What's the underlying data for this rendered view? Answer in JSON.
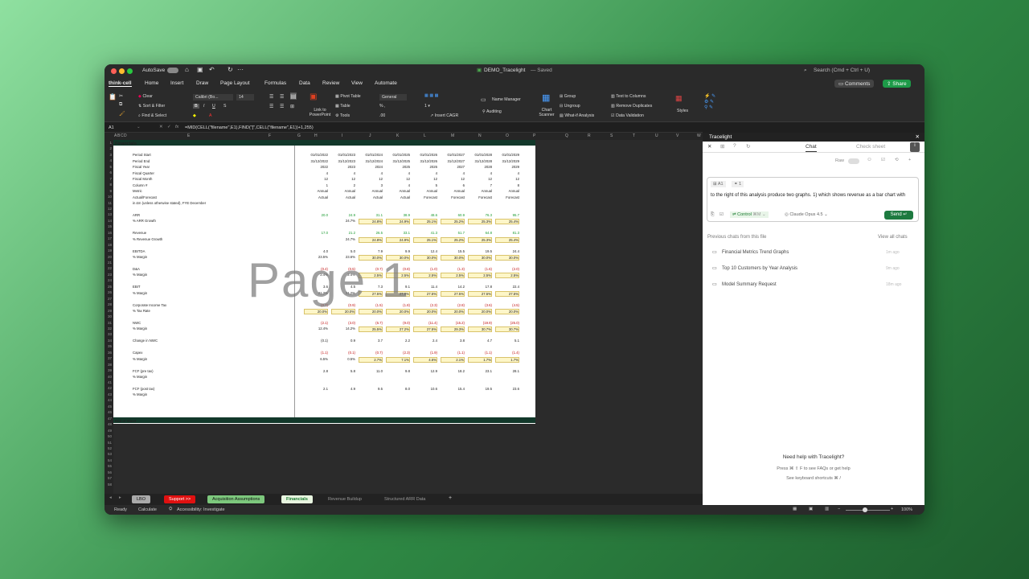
{
  "window": {
    "title": "DEMO_Tracelight",
    "saved": "— Saved",
    "search": "Search (Cmd + Ctrl + U)",
    "autosave": "AutoSave"
  },
  "ribbon_tabs": [
    "think-cell",
    "Home",
    "Insert",
    "Draw",
    "Page Layout",
    "Formulas",
    "Data",
    "Review",
    "View",
    "Automate"
  ],
  "top_buttons": {
    "comments": "Comments",
    "share": "Share"
  },
  "ribbon": {
    "clear": "Clear",
    "sort": "Sort & Filter",
    "find": "Find & Select",
    "font": "Calibri (Bo...",
    "size": "14",
    "ppt": "Link to PowerPoint",
    "pivot": "Pivot Table",
    "table": "Table",
    "tools": "Tools",
    "numfmt": "General",
    "cagr": "Insert CAGR",
    "name_manager": "Name Manager",
    "auditing": "Auditing",
    "chart_scanner": "Chart Scanner",
    "group": "Group",
    "ungroup": "Ungroup",
    "whatif": "What-if Analysis",
    "text_cols": "Text to Columns",
    "remove_dup": "Remove Duplicates",
    "validation": "Data Validation",
    "styles": "Styles"
  },
  "formula_bar": {
    "cell": "A1",
    "formula": "=MID(CELL(\"filename\",E1),FIND(\"]\",CELL(\"filename\",E1))+1,255)"
  },
  "columns": [
    "A",
    "B",
    "C",
    "D",
    "E",
    "F",
    "G",
    "H",
    "I",
    "J",
    "K",
    "L",
    "M",
    "N",
    "O",
    "P",
    "Q",
    "R",
    "S",
    "T",
    "U",
    "V",
    "W"
  ],
  "sheet": {
    "title": "Financials",
    "footer": "End of Sheet",
    "header_rows": [
      {
        "label": "Period Start",
        "values": [
          "01/01/2022",
          "01/01/2023",
          "01/01/2024",
          "01/01/2025",
          "01/01/2026",
          "01/01/2027",
          "01/01/2028",
          "01/01/2029"
        ]
      },
      {
        "label": "Period End",
        "values": [
          "31/12/2022",
          "31/12/2023",
          "31/12/2024",
          "31/12/2025",
          "31/12/2026",
          "31/12/2027",
          "31/12/2028",
          "31/12/2029"
        ]
      },
      {
        "label": "Fiscal Year",
        "values": [
          "2022",
          "2023",
          "2024",
          "2025",
          "2026",
          "2027",
          "2028",
          "2029"
        ]
      },
      {
        "label": "Fiscal Quarter",
        "values": [
          "4",
          "4",
          "4",
          "4",
          "4",
          "4",
          "4",
          "4"
        ]
      },
      {
        "label": "Fiscal Month",
        "values": [
          "12",
          "12",
          "12",
          "12",
          "12",
          "12",
          "12",
          "12"
        ]
      },
      {
        "label": "Column #",
        "values": [
          "1",
          "2",
          "3",
          "4",
          "5",
          "6",
          "7",
          "8"
        ]
      },
      {
        "label": "Metric",
        "values": [
          "Annual",
          "Annual",
          "Annual",
          "Annual",
          "Annual",
          "Annual",
          "Annual",
          "Annual"
        ]
      },
      {
        "label": "Actual/Forecast",
        "values": [
          "Actual",
          "Actual",
          "Actual",
          "Actual",
          "Forecast",
          "Forecast",
          "Forecast",
          "Forecast"
        ]
      },
      {
        "label": "in £m (unless otherwise stated), FYE December",
        "values": []
      }
    ],
    "data_rows": [
      {
        "row": 13,
        "label": "ARR",
        "color": "green",
        "values": [
          "20.0",
          "24.9",
          "31.1",
          "38.9",
          "48.6",
          "60.9",
          "76.3",
          "95.7"
        ]
      },
      {
        "row": 14,
        "label": "% ARR Growth",
        "color": "black",
        "values": [
          "",
          "24.7%",
          "24.8%",
          "24.9%",
          "25.1%",
          "25.2%",
          "25.3%",
          "25.4%"
        ]
      },
      {
        "row": 16,
        "label": "Revenue",
        "color": "green",
        "values": [
          "17.0",
          "21.2",
          "26.5",
          "33.1",
          "41.3",
          "51.7",
          "64.8",
          "81.3"
        ]
      },
      {
        "row": 17,
        "label": "% Revenue Growth",
        "color": "black",
        "values": [
          "",
          "24.7%",
          "24.8%",
          "24.9%",
          "25.1%",
          "25.2%",
          "25.3%",
          "25.4%"
        ]
      },
      {
        "row": 19,
        "label": "EBITDA",
        "color": "black",
        "values": [
          "4.0",
          "5.0",
          "7.9",
          "9.9",
          "12.4",
          "15.5",
          "19.5",
          "24.4"
        ]
      },
      {
        "row": 20,
        "label": "% Margin",
        "color": "black",
        "values": [
          "23.5%",
          "23.6%",
          "30.0%",
          "30.0%",
          "30.0%",
          "30.0%",
          "30.0%",
          "30.0%"
        ]
      },
      {
        "row": 22,
        "label": "D&A",
        "color": "red",
        "values": [
          "(0.4)",
          "(0.5)",
          "(0.7)",
          "(0.8)",
          "(1.0)",
          "(1.3)",
          "(1.6)",
          "(2.0)"
        ]
      },
      {
        "row": 23,
        "label": "% Margin",
        "color": "black",
        "values": [
          "2.4%",
          "2.4%",
          "2.5%",
          "2.5%",
          "2.5%",
          "2.5%",
          "2.5%",
          "2.5%"
        ]
      },
      {
        "row": 25,
        "label": "EBIT",
        "color": "black",
        "values": [
          "3.6",
          "4.5",
          "7.3",
          "9.1",
          "11.4",
          "14.2",
          "17.8",
          "22.4"
        ]
      },
      {
        "row": 26,
        "label": "% Margin",
        "color": "black",
        "values": [
          "21.2%",
          "21.2%",
          "27.5%",
          "27.5%",
          "27.5%",
          "27.5%",
          "27.5%",
          "27.5%"
        ]
      },
      {
        "row": 28,
        "label": "Corporate Income Tax",
        "color": "red",
        "values": [
          "(0.7)",
          "(0.9)",
          "(1.5)",
          "(1.8)",
          "(2.3)",
          "(2.8)",
          "(3.6)",
          "(4.5)"
        ]
      },
      {
        "row": 29,
        "label": "% Tax Rate",
        "color": "black",
        "values": [
          "20.0%",
          "20.0%",
          "20.0%",
          "20.0%",
          "20.0%",
          "20.0%",
          "20.0%",
          "20.0%"
        ]
      },
      {
        "row": 31,
        "label": "NWC",
        "color": "red",
        "values": [
          "(2.1)",
          "(3.0)",
          "(6.7)",
          "(9.0)",
          "(11.4)",
          "(15.2)",
          "(19.9)",
          "(25.0)"
        ]
      },
      {
        "row": 32,
        "label": "% Margin",
        "color": "black",
        "values": [
          "12.4%",
          "14.2%",
          "25.5%",
          "27.2%",
          "27.5%",
          "29.3%",
          "30.7%",
          "30.7%"
        ]
      },
      {
        "row": 34,
        "label": "Change in NWC",
        "color": "black",
        "values": [
          "(0.1)",
          "0.9",
          "3.7",
          "2.2",
          "2.4",
          "3.8",
          "4.7",
          "5.1"
        ]
      },
      {
        "row": 36,
        "label": "Capex",
        "color": "red",
        "values": [
          "(1.1)",
          "(0.1)",
          "(0.7)",
          "(2.3)",
          "(1.9)",
          "(1.1)",
          "(1.1)",
          "(1.4)"
        ]
      },
      {
        "row": 37,
        "label": "% Margin",
        "color": "black",
        "values": [
          "6.5%",
          "0.5%",
          "2.7%",
          "7.1%",
          "4.6%",
          "2.1%",
          "1.7%",
          "1.7%"
        ]
      },
      {
        "row": 39,
        "label": "FCF (pre tax)",
        "color": "black",
        "values": [
          "2.8",
          "5.8",
          "11.0",
          "9.8",
          "12.9",
          "18.2",
          "23.1",
          "28.1"
        ]
      },
      {
        "row": 40,
        "label": "% Margin",
        "color": "black",
        "values": []
      },
      {
        "row": 42,
        "label": "FCF (post tax)",
        "color": "black",
        "values": [
          "2.1",
          "4.9",
          "9.5",
          "8.0",
          "10.6",
          "15.4",
          "19.5",
          "23.6"
        ]
      },
      {
        "row": 43,
        "label": "% Margin",
        "color": "black",
        "values": []
      }
    ]
  },
  "watermark": "Page 1",
  "sheet_tabs": [
    {
      "label": "LBO",
      "style": "gray"
    },
    {
      "label": "Support >>",
      "style": "red"
    },
    {
      "label": "Acquisition Assumptions",
      "style": "green"
    },
    {
      "label": "Financials",
      "style": "active"
    },
    {
      "label": "Revenue Buildup",
      "style": "plain"
    },
    {
      "label": "Structured ARR Data",
      "style": "plain"
    }
  ],
  "status": {
    "ready": "Ready",
    "calculate": "Calculate",
    "accessibility": "Accessibility: Investigate",
    "zoom": "100%"
  },
  "panel": {
    "title": "Tracelight",
    "tab_chat": "Chat",
    "tab_check": "Check sheet",
    "raw": "Raw",
    "cell_chip": "A1",
    "count_chip": "1",
    "prompt": "to the right of this analysis produce two graphs. 1) which shows revenue as a bar chart with",
    "control": "Control",
    "model": "Claude Opus 4.5",
    "send": "Send",
    "prev_title": "Previous chats from this file",
    "view_all": "View all chats",
    "chats": [
      {
        "title": "Financial Metrics Trend Graphs",
        "time": "1m ago"
      },
      {
        "title": "Top 10 Customers by Year Analysis",
        "time": "9m ago"
      },
      {
        "title": "Model Summary Request",
        "time": "18m ago"
      }
    ],
    "help_title": "Need help with Tracelight?",
    "help_line1": "Press  ⌘ ⇧ F  to see FAQs or get help",
    "help_line2": "See keyboard shortcuts  ⌘ /"
  }
}
